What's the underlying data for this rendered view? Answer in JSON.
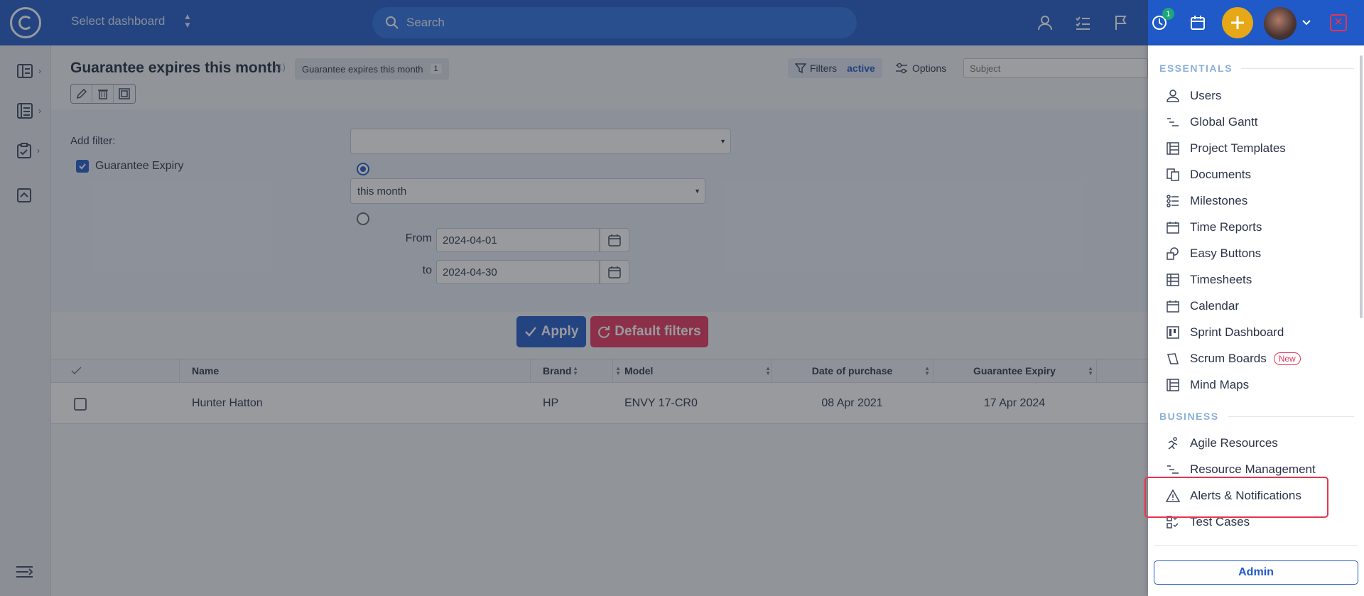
{
  "topbar": {
    "dashboard_select": "Select dashboard",
    "search_placeholder": "Search",
    "timer_badge": "1"
  },
  "page": {
    "title": "Guarantee expires this month",
    "title_count": "(1)",
    "query_chip": "Guarantee expires this month",
    "query_chip_count": "1",
    "filters_label": "Filters",
    "filters_state": "active",
    "options_label": "Options",
    "subject_placeholder": "Subject"
  },
  "filters": {
    "add_filter_label": "Add filter:",
    "guarantee_checkbox_label": "Guarantee Expiry",
    "period_value": "this month",
    "from_label": "From",
    "from_value": "2024-04-01",
    "to_label": "to",
    "to_value": "2024-04-30",
    "apply_label": "Apply",
    "default_label": "Default filters"
  },
  "table": {
    "headers": [
      "Name",
      "Brand",
      "Model",
      "Date of purchase",
      "Guarantee Expiry"
    ],
    "rows": [
      {
        "name": "Hunter Hatton",
        "brand": "HP",
        "model": "ENVY 17-CR0",
        "purchase": "08 Apr 2021",
        "expiry": "17 Apr 2024"
      }
    ]
  },
  "menu": {
    "essentials_heading": "ESSENTIALS",
    "essentials": [
      {
        "label": "Users",
        "icon": "user-icon"
      },
      {
        "label": "Global Gantt",
        "icon": "gantt-icon"
      },
      {
        "label": "Project Templates",
        "icon": "template-icon"
      },
      {
        "label": "Documents",
        "icon": "documents-icon"
      },
      {
        "label": "Milestones",
        "icon": "milestones-icon"
      },
      {
        "label": "Time Reports",
        "icon": "calendar-icon"
      },
      {
        "label": "Easy Buttons",
        "icon": "shapes-icon"
      },
      {
        "label": "Timesheets",
        "icon": "table-icon"
      },
      {
        "label": "Calendar",
        "icon": "calendar-icon"
      },
      {
        "label": "Sprint Dashboard",
        "icon": "dashboard-icon"
      },
      {
        "label": "Scrum Boards",
        "icon": "board-icon",
        "badge": "New"
      },
      {
        "label": "Mind Maps",
        "icon": "mindmap-icon"
      }
    ],
    "business_heading": "BUSINESS",
    "business": [
      {
        "label": "Agile Resources",
        "icon": "runner-icon"
      },
      {
        "label": "Resource Management",
        "icon": "gantt-icon"
      },
      {
        "label": "Alerts & Notifications",
        "icon": "warning-icon"
      },
      {
        "label": "Test Cases",
        "icon": "testcases-icon"
      }
    ],
    "admin_label": "Admin"
  },
  "colors": {
    "brand_blue": "#1f5ac8",
    "accent_yellow": "#e6a817",
    "danger": "#e8345c",
    "success_badge": "#1ea67a"
  }
}
